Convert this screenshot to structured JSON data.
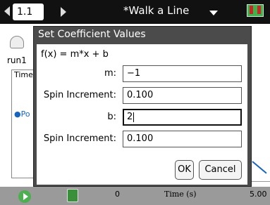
{
  "top_bar": {
    "page_tab": "1.1",
    "document_title": "*Walk a Line"
  },
  "background_app": {
    "run_tab": "run1",
    "column_header": "Time",
    "data_set_label": "Po",
    "axis": {
      "x_min": "0",
      "x_title": "Time (s)",
      "x_max": "5.00"
    }
  },
  "dialog": {
    "title": "Set Coefficient Values",
    "formula": "f(x) = m*x + b",
    "fields": [
      {
        "label": "m:",
        "value": "−1"
      },
      {
        "label": "Spin Increment:",
        "value": "0.100"
      },
      {
        "label": "b:",
        "value": "2"
      },
      {
        "label": "Spin Increment:",
        "value": "0.100"
      }
    ],
    "ok_label": "OK",
    "cancel_label": "Cancel"
  },
  "colors": {
    "dialog_frame": "#4b4b4b",
    "battery_fill": "#39b54a",
    "graph_line": "#1565c0"
  },
  "icons": [
    "tab-left-arrow-icon",
    "tab-right-arrow-icon",
    "title-menu-caret-icon",
    "battery-icon",
    "gauge-icon",
    "play-icon",
    "data-table-icon"
  ]
}
